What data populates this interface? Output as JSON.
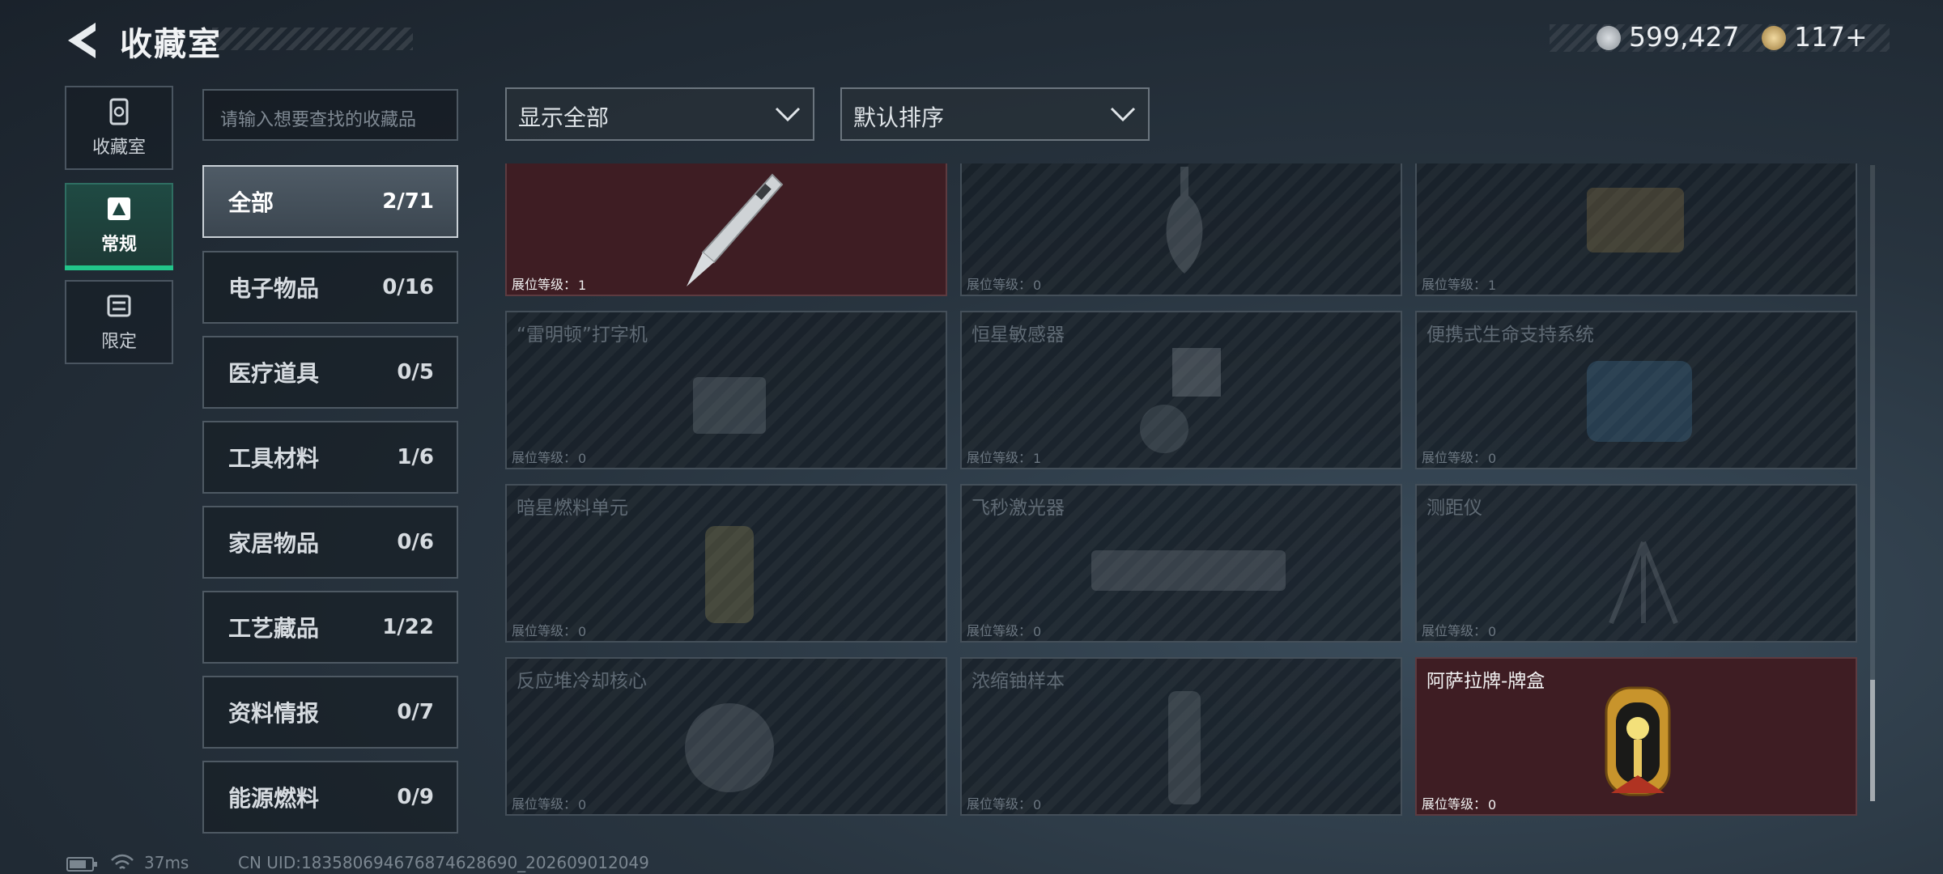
{
  "header": {
    "title": "收藏室",
    "currency": [
      {
        "icon": "silver-coin-icon",
        "value": "599,427"
      },
      {
        "icon": "gold-coin-icon",
        "value": "117+"
      }
    ]
  },
  "side_tabs": [
    {
      "label": "收藏室",
      "icon": "collection-room-icon",
      "active": false
    },
    {
      "label": "常规",
      "icon": "regular-icon",
      "active": true
    },
    {
      "label": "限定",
      "icon": "limited-icon",
      "active": false
    }
  ],
  "search": {
    "placeholder": "请输入想要查找的收藏品"
  },
  "categories": [
    {
      "name": "全部",
      "count": "2/71"
    },
    {
      "name": "电子物品",
      "count": "0/16"
    },
    {
      "name": "医疗道具",
      "count": "0/5"
    },
    {
      "name": "工具材料",
      "count": "1/6"
    },
    {
      "name": "家居物品",
      "count": "0/6"
    },
    {
      "name": "工艺藏品",
      "count": "1/22"
    },
    {
      "name": "资料情报",
      "count": "0/7"
    },
    {
      "name": "能源燃料",
      "count": "0/9"
    }
  ],
  "filters": {
    "display": "显示全部",
    "sort": "默认排序"
  },
  "level_label": "展位等级：",
  "items": [
    {
      "name": "",
      "level": "1",
      "owned": true,
      "icon": "pen-icon"
    },
    {
      "name": "",
      "level": "0",
      "owned": false,
      "icon": "vase-icon"
    },
    {
      "name": "",
      "level": "1",
      "owned": false,
      "icon": "machine-icon"
    },
    {
      "name": "“雷明顿”打字机",
      "level": "0",
      "owned": false,
      "icon": "typewriter-icon"
    },
    {
      "name": "恒星敏感器",
      "level": "1",
      "owned": false,
      "icon": "sensor-icon"
    },
    {
      "name": "便携式生命支持系统",
      "level": "0",
      "owned": false,
      "icon": "life-support-icon"
    },
    {
      "name": "暗星燃料单元",
      "level": "0",
      "owned": false,
      "icon": "fuel-cell-icon"
    },
    {
      "name": "飞秒激光器",
      "level": "0",
      "owned": false,
      "icon": "laser-icon"
    },
    {
      "name": "测距仪",
      "level": "0",
      "owned": false,
      "icon": "rangefinder-icon"
    },
    {
      "name": "反应堆冷却核心",
      "level": "0",
      "owned": false,
      "icon": "reactor-core-icon"
    },
    {
      "name": "浓缩铀样本",
      "level": "0",
      "owned": false,
      "icon": "uranium-sample-icon"
    },
    {
      "name": "阿萨拉牌-牌盒",
      "level": "0",
      "owned": true,
      "icon": "card-box-icon"
    }
  ],
  "footer": {
    "ping": "37ms",
    "uid": "CN UID:1835806946768746​28690_202609012049"
  },
  "colors": {
    "accent": "#22c58a",
    "owned_card": "#3e1d23"
  }
}
